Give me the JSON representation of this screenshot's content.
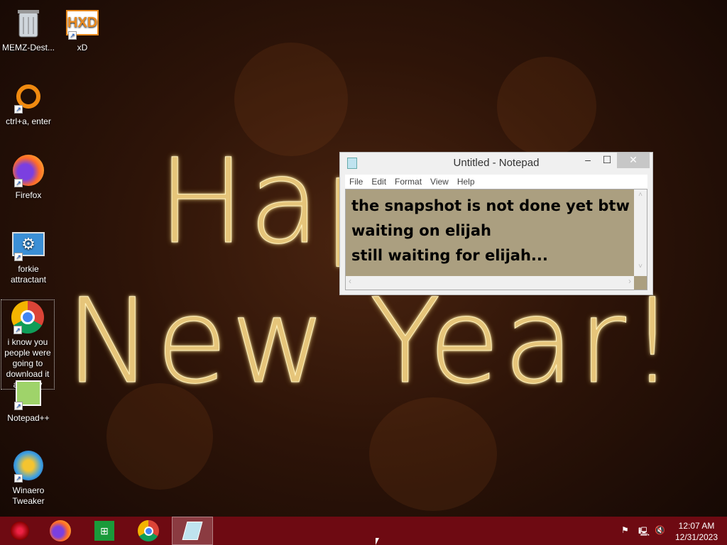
{
  "wallpaper": {
    "text_line1": "Happy",
    "text_line2": "New Year!"
  },
  "desktop_icons": [
    {
      "label": "MEMZ-Dest...",
      "icon": "recycle-bin-icon"
    },
    {
      "label": "xD",
      "icon": "hxd-icon"
    },
    {
      "label": "ctrl+a, enter",
      "icon": "orange-ring-icon"
    },
    {
      "label": "Firefox",
      "icon": "firefox-icon"
    },
    {
      "label": "forkie attractant",
      "icon": "settings-computer-icon"
    },
    {
      "label": "i know you people were going to download it anyway",
      "icon": "chrome-icon"
    },
    {
      "label": "Notepad++",
      "icon": "notepadpp-icon"
    },
    {
      "label": "Winaero Tweaker",
      "icon": "winaero-icon"
    }
  ],
  "notepad": {
    "title": "Untitled - Notepad",
    "menu": [
      "File",
      "Edit",
      "Format",
      "View",
      "Help"
    ],
    "content": "the snapshot is not done yet btw\nwaiting on elijah\nstill waiting for elijah...",
    "bg_color": "#ab9f80"
  },
  "taskbar": {
    "color": "#6e0a12",
    "items": [
      "start-orb",
      "firefox",
      "store",
      "chrome",
      "notepad"
    ],
    "active": "notepad"
  },
  "tray": {
    "time": "12:07 AM",
    "date": "12/31/2023"
  }
}
